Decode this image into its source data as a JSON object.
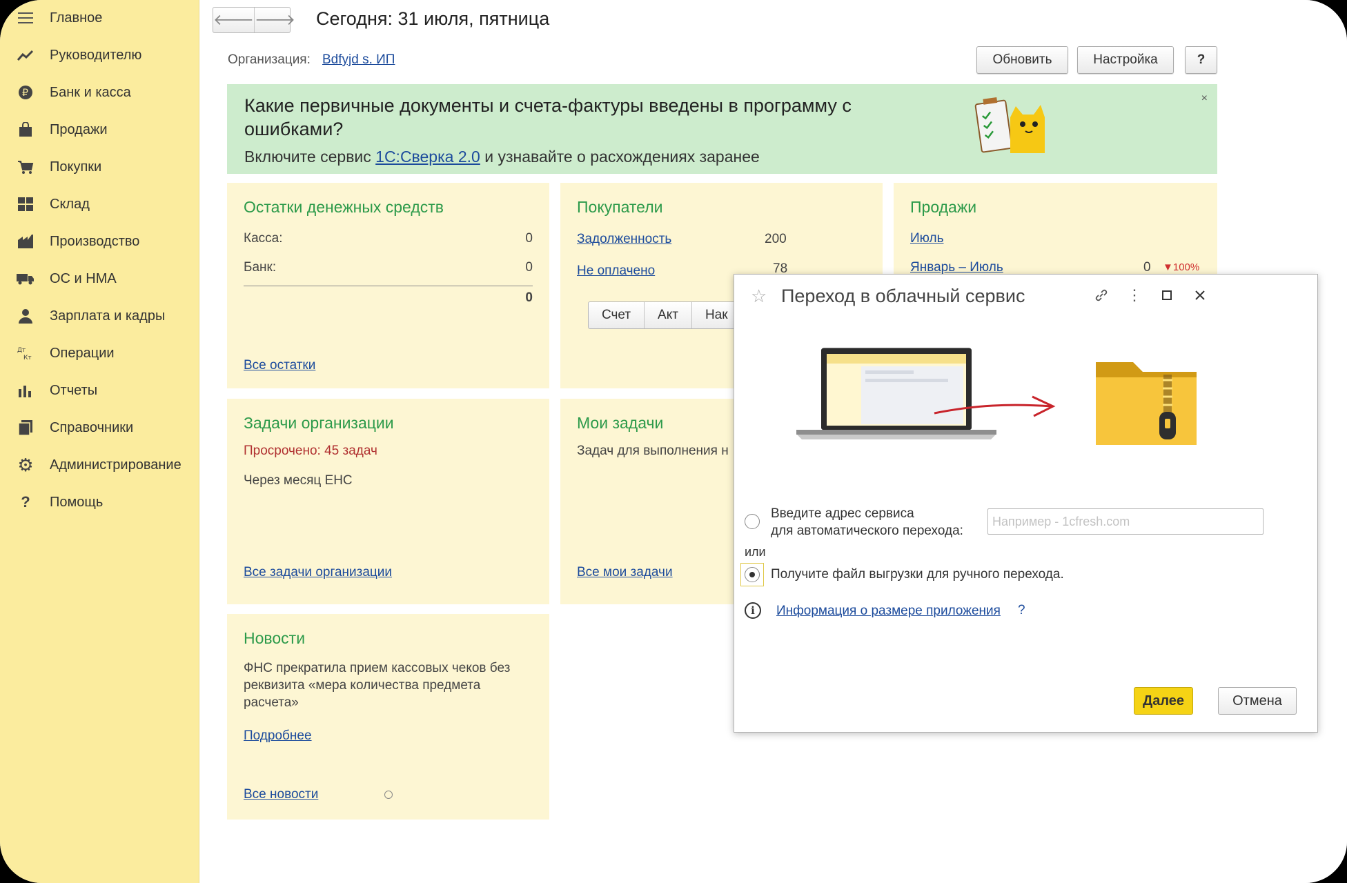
{
  "sidebar": {
    "items": [
      {
        "label": "Главное",
        "icon": "menu-icon"
      },
      {
        "label": "Руководителю",
        "icon": "trend-icon"
      },
      {
        "label": "Банк и касса",
        "icon": "ruble-icon"
      },
      {
        "label": "Продажи",
        "icon": "bag-icon"
      },
      {
        "label": "Покупки",
        "icon": "cart-icon"
      },
      {
        "label": "Склад",
        "icon": "warehouse-icon"
      },
      {
        "label": "Производство",
        "icon": "factory-icon"
      },
      {
        "label": "ОС и НМА",
        "icon": "truck-icon"
      },
      {
        "label": "Зарплата и кадры",
        "icon": "person-icon"
      },
      {
        "label": "Операции",
        "icon": "dt-kt-icon"
      },
      {
        "label": "Отчеты",
        "icon": "bar-chart-icon"
      },
      {
        "label": "Справочники",
        "icon": "books-icon"
      },
      {
        "label": "Администрирование",
        "icon": "gear-icon"
      },
      {
        "label": "Помощь",
        "icon": "question-icon"
      }
    ]
  },
  "header": {
    "title": "Сегодня: 31 июля, пятница",
    "org_label": "Организация:",
    "org_link": "Bdfyjd s. ИП",
    "refresh": "Обновить",
    "settings": "Настройка",
    "help": "?"
  },
  "banner": {
    "title": "Какие первичные документы и счета-фактуры введены в программу с ошибками?",
    "sub_before": "Включите сервис ",
    "sub_link": "1С:Сверка 2.0",
    "sub_after": " и узнавайте о расхождениях заранее",
    "close": "×"
  },
  "cash": {
    "title": "Остатки денежных средств",
    "kassa_label": "Касса:",
    "kassa_value": "0",
    "bank_label": "Банк:",
    "bank_value": "0",
    "total": "0",
    "link": "Все остатки"
  },
  "buyers": {
    "title": "Покупатели",
    "debt_link": "Задолженность",
    "debt_value": "200",
    "unpaid_link": "Не оплачено",
    "unpaid_value": "78",
    "tabs": [
      "Счет",
      "Акт",
      "Нак"
    ]
  },
  "sales": {
    "title": "Продажи",
    "month_link": "Июль",
    "period_link": "Январь – Июль",
    "period_value": "0",
    "change": "▼100%",
    "change_color": "#d03030"
  },
  "org_tasks": {
    "title": "Задачи организации",
    "overdue": "Просрочено: 45 задач",
    "next": "Через месяц ЕНС",
    "link": "Все задачи организации"
  },
  "my_tasks": {
    "title": "Мои задачи",
    "text": "Задач для выполнения н",
    "link": "Все мои задачи"
  },
  "news": {
    "title": "Новости",
    "text": "ФНС прекратила прием кассовых чеков без реквизита «мера количества предмета расчета»",
    "more": "Подробнее",
    "all": "Все новости"
  },
  "dialog": {
    "title": "Переход в облачный сервис",
    "option1_line1": "Введите адрес сервиса",
    "option1_line2": "для автоматического перехода:",
    "input_placeholder": "Например - 1cfresh.com",
    "or": "или",
    "option2": "Получите файл выгрузки для ручного перехода.",
    "info_link": "Информация о размере приложения",
    "info_q": "?",
    "next": "Далее",
    "cancel": "Отмена",
    "accent": "#f5d315"
  }
}
